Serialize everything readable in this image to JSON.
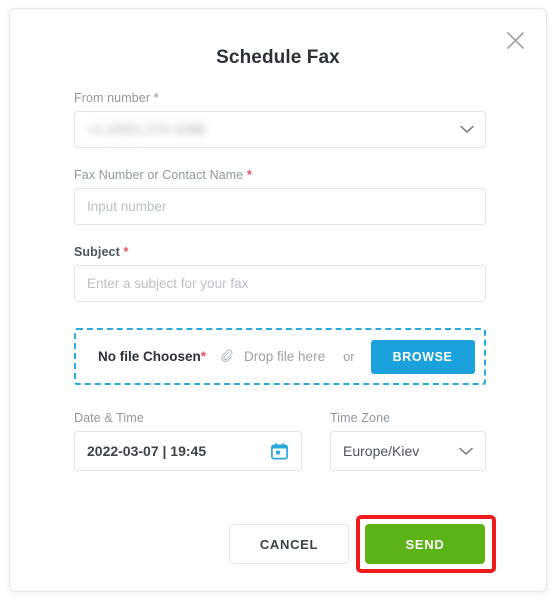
{
  "modal": {
    "title": "Schedule Fax",
    "close_icon": "close-icon"
  },
  "form": {
    "from_number": {
      "label": "From number",
      "required_marker": "*",
      "value": "+1 (000) 274-1088",
      "value_redacted": true,
      "chevron_icon": "chevron-down-icon"
    },
    "fax_number": {
      "label": "Fax Number or Contact Name",
      "required_marker": "*",
      "value": "",
      "placeholder": "Input number"
    },
    "subject": {
      "label": "Subject",
      "required_marker": "*",
      "value": "",
      "placeholder": "Enter a subject for your fax"
    },
    "attachment": {
      "no_file_text": "No file Choosen",
      "required_marker": "*",
      "clip_icon": "paperclip-icon",
      "drop_text": "Drop file here",
      "or_text": "or",
      "browse_label": "BROWSE"
    },
    "date_time": {
      "label": "Date & Time",
      "value": "2022-03-07 | 19:45",
      "calendar_icon": "calendar-icon"
    },
    "time_zone": {
      "label": "Time Zone",
      "value": "Europe/Kiev",
      "chevron_icon": "chevron-down-icon"
    }
  },
  "footer": {
    "cancel_label": "CANCEL",
    "send_label": "SEND"
  },
  "colors": {
    "accent_blue": "#1ba2dd",
    "send_green": "#5cb318",
    "required_red": "#e8505b",
    "highlight_red": "#f01b1b",
    "title_dark": "#2b3138",
    "label_gray": "#8e97a0"
  }
}
